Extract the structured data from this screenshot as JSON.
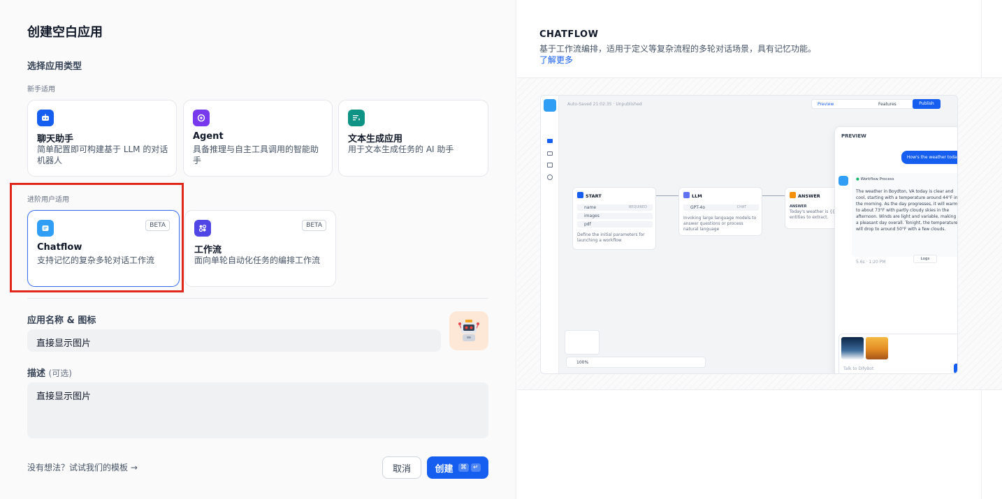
{
  "dialog": {
    "title": "创建空白应用",
    "app_type_label": "选择应用类型",
    "beginner_label": "新手适用",
    "advanced_label": "进阶用户适用",
    "beginner_types": [
      {
        "name": "聊天助手",
        "desc": "简单配置即可构建基于 LLM 的对话机器人",
        "icon": "chat-bot-icon",
        "color": "#155eef"
      },
      {
        "name": "Agent",
        "desc": "具备推理与自主工具调用的智能助手",
        "icon": "agent-icon",
        "color": "#7839ee"
      },
      {
        "name": "文本生成应用",
        "desc": "用于文本生成任务的 AI 助手",
        "icon": "text-generate-icon",
        "color": "#0e9384"
      }
    ],
    "advanced_types": [
      {
        "name": "Chatflow",
        "desc": "支持记忆的复杂多轮对话工作流",
        "badge": "BETA",
        "icon": "chatflow-icon",
        "color": "#2f9ef4"
      },
      {
        "name": "工作流",
        "desc": "面向单轮自动化任务的编排工作流",
        "badge": "BETA",
        "icon": "workflow-icon",
        "color": "#4f46e5"
      }
    ],
    "name_label": "应用名称 & 图标",
    "name_value": "直接显示图片",
    "desc_label": "描述",
    "desc_optional": "(可选)",
    "desc_value": "直接显示图片",
    "template_link": "没有想法？试试我们的模板",
    "cancel_label": "取消",
    "create_label": "创建",
    "create_shortcut_1": "⌘",
    "create_shortcut_2": "↵"
  },
  "preview": {
    "heading": "CHATFLOW",
    "description": "基于工作流编排，适用于定义等复杂流程的多轮对话场景，具有记忆功能。",
    "learn_more": "了解更多",
    "mock": {
      "autosaved": "Auto-Saved 21:02:35 · Unpublished",
      "preview_btn": "Preview",
      "features_btn": "Features",
      "publish_btn": "Publish",
      "start_title": "START",
      "start_vars": [
        "name",
        "images",
        "pdf"
      ],
      "required": "REQUIRED",
      "start_desc": "Define the initial parameters for launching a workflow",
      "llm_title": "LLM",
      "llm_model": "GPT-4o",
      "llm_mode": "CHAT",
      "llm_desc": "Invoking large language models to answer questions or process natural language",
      "answer_title": "ANSWER",
      "answer_label": "ANSWER",
      "answer_text": "Today's weather is {{#...",
      "answer_text2": "entities to extract.",
      "zoom": "100%",
      "preview_title": "PREVIEW",
      "user_msg": "How's the weather today",
      "workflow_process": "Workflow Process",
      "bot_reply": "The weather in Boydton, VA today is clear and cool, starting with a temperature around 44°F in the morning. As the day progresses, it will warm up to about 73°F with partly cloudy skies in the afternoon. Winds are light and variable, making for a pleasant day overall. Tonight, the temperature will drop to around 50°F with a few clouds.",
      "reply_meta": "5.6s · 1:20 PM",
      "logs": "Logs",
      "chat_placeholder": "Talk to DifyBot"
    }
  }
}
